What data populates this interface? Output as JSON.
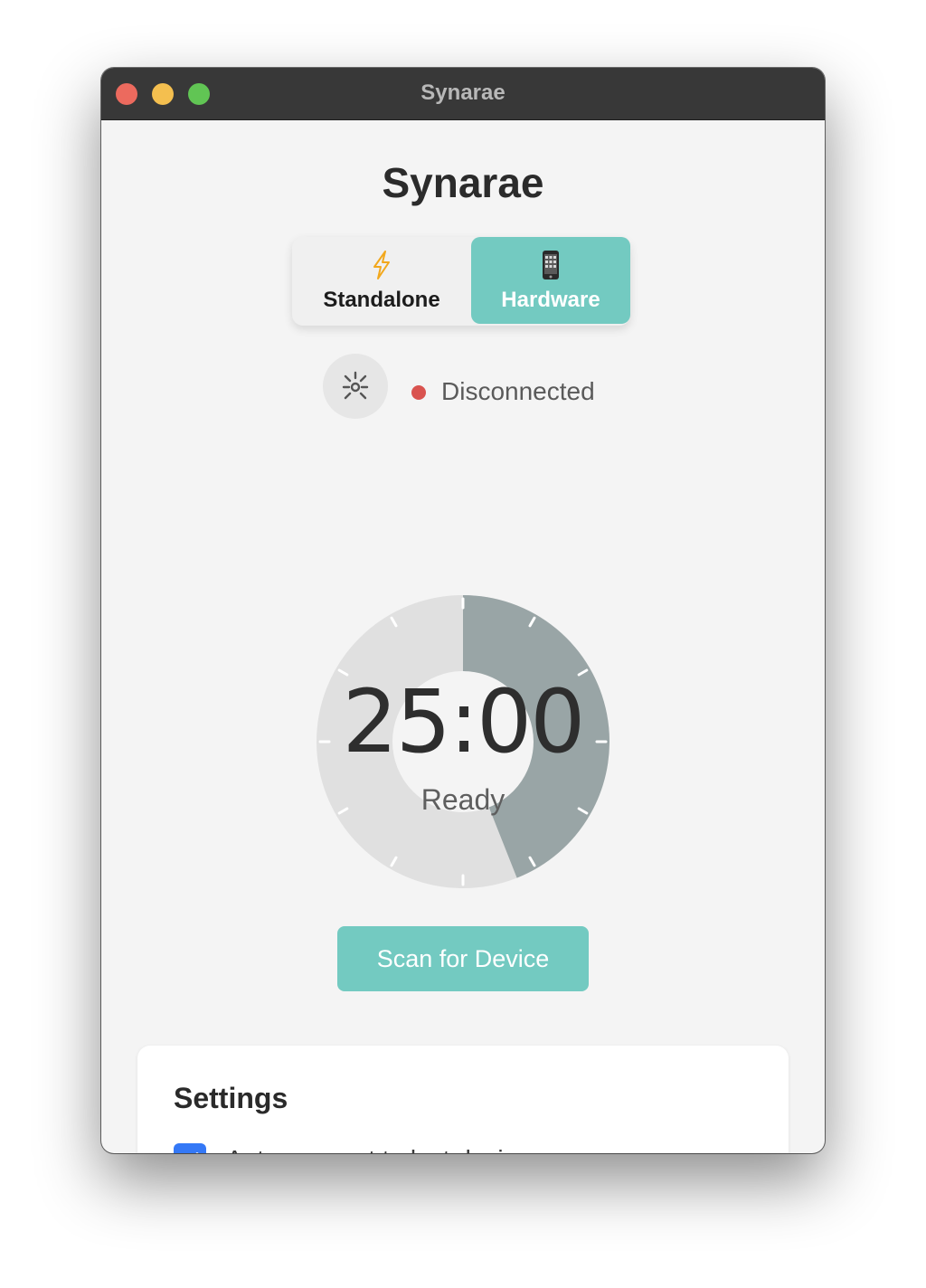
{
  "window": {
    "title": "Synarae"
  },
  "app": {
    "title": "Synarae"
  },
  "mode_toggle": {
    "options": [
      {
        "label": "Standalone",
        "icon": "lightning-icon",
        "selected": false
      },
      {
        "label": "Hardware",
        "icon": "phone-icon",
        "selected": true
      }
    ]
  },
  "connection": {
    "icon": "bluetooth-searching-icon",
    "status": "Disconnected",
    "status_color": "#d9534f"
  },
  "timer": {
    "time": "25:00",
    "state": "Ready",
    "progress_fraction": 0.44
  },
  "actions": {
    "scan_label": "Scan for Device"
  },
  "settings": {
    "title": "Settings",
    "items": [
      {
        "label": "Auto-connect to last device",
        "checked": true
      }
    ]
  },
  "colors": {
    "accent": "#73cac1",
    "status_disconnected": "#d9534f",
    "checkbox": "#3478f6"
  }
}
